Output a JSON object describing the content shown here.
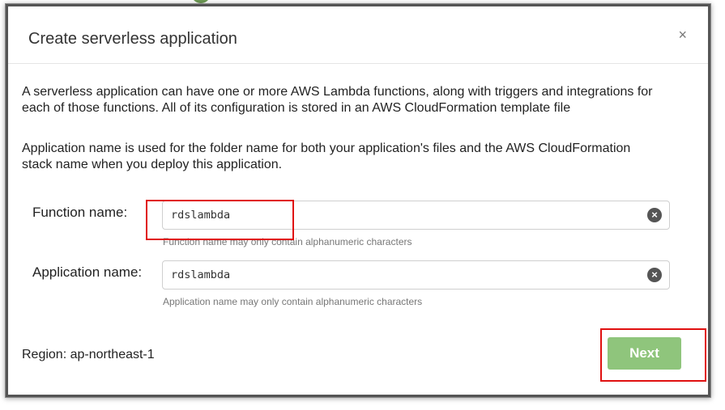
{
  "dialog": {
    "title": "Create serverless application",
    "close_label": "×",
    "description_1": "A serverless application can have one or more AWS Lambda functions, along with triggers and integrations for each of those functions. All of its configuration is stored in an AWS CloudFormation template file",
    "description_2": "Application name is used for the folder name for both your application's files and the AWS CloudFormation stack name when you deploy this application."
  },
  "form": {
    "function_name": {
      "label": "Function name:",
      "value": "rdslambda",
      "hint": "Function name may only contain alphanumeric characters",
      "clear_icon": "clear-circle-icon"
    },
    "application_name": {
      "label": "Application name:",
      "value": "rdslambda",
      "hint": "Application name may only contain alphanumeric characters",
      "clear_icon": "clear-circle-icon"
    }
  },
  "footer": {
    "region": "Region: ap-northeast-1",
    "next_label": "Next"
  },
  "colors": {
    "next_button": "#8fc57c",
    "highlight": "#e01010"
  }
}
